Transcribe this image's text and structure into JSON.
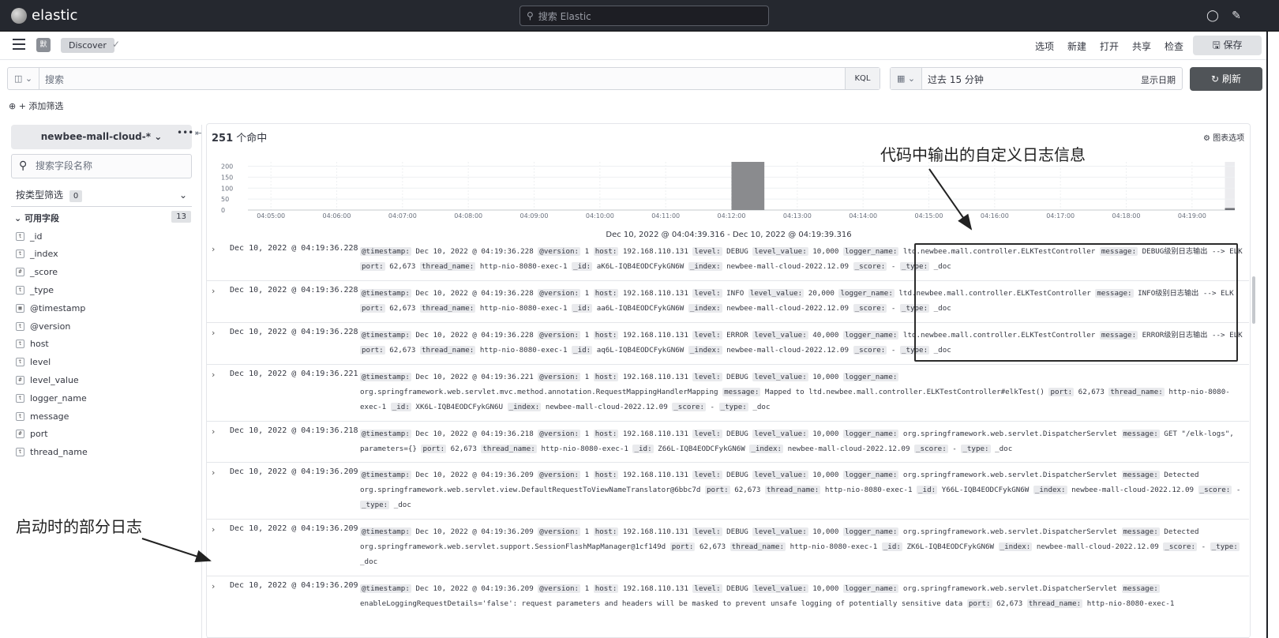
{
  "header": {
    "brand": "elastic",
    "search_placeholder": "搜索 Elastic",
    "icons": [
      "help-icon",
      "newsfeed-icon"
    ]
  },
  "navbar": {
    "space_badge": "默",
    "breadcrumb": "Discover",
    "links": [
      "选项",
      "新建",
      "打开",
      "共享",
      "检查"
    ],
    "save_label": "保存"
  },
  "querybar": {
    "placeholder": "搜索",
    "language": "KQL",
    "date_range": "过去 15 分钟",
    "show_dates": "显示日期",
    "refresh_label": "刷新",
    "add_filter": "+ 添加筛选"
  },
  "sidebar": {
    "index_pattern": "newbee-mall-cloud-*",
    "field_search_placeholder": "搜索字段名称",
    "type_filter_label": "按类型筛选",
    "type_filter_count": "0",
    "available_label": "可用字段",
    "available_count": "13",
    "fields": [
      {
        "name": "_id",
        "type": "t"
      },
      {
        "name": "_index",
        "type": "t"
      },
      {
        "name": "_score",
        "type": "#"
      },
      {
        "name": "_type",
        "type": "t"
      },
      {
        "name": "@timestamp",
        "type": "cal"
      },
      {
        "name": "@version",
        "type": "t"
      },
      {
        "name": "host",
        "type": "t"
      },
      {
        "name": "level",
        "type": "t"
      },
      {
        "name": "level_value",
        "type": "#"
      },
      {
        "name": "logger_name",
        "type": "t"
      },
      {
        "name": "message",
        "type": "t"
      },
      {
        "name": "port",
        "type": "#"
      },
      {
        "name": "thread_name",
        "type": "t"
      }
    ]
  },
  "main": {
    "hits_count": "251",
    "hits_label": "个命中",
    "chart_options": "图表选项",
    "histogram_range": "Dec 10, 2022 @ 04:04:39.316 - Dec 10, 2022 @ 04:19:39.316"
  },
  "chart_data": {
    "type": "bar",
    "x_ticks": [
      "04:05:00",
      "04:06:00",
      "04:07:00",
      "04:08:00",
      "04:09:00",
      "04:10:00",
      "04:11:00",
      "04:12:00",
      "04:13:00",
      "04:14:00",
      "04:15:00",
      "04:16:00",
      "04:17:00",
      "04:18:00",
      "04:19:00"
    ],
    "y_ticks": [
      0,
      50,
      100,
      150,
      200
    ],
    "ylim": [
      0,
      220
    ],
    "bars": [
      {
        "start": "04:12:00",
        "end": "04:12:30",
        "value": 240
      },
      {
        "start": "04:19:30",
        "end": "04:19:39",
        "value": 9
      }
    ],
    "partial_bucket_start": "04:19:30",
    "grid": true
  },
  "rows": [
    {
      "time": "Dec 10, 2022 @ 04:19:36.228",
      "source": [
        [
          "@timestamp:",
          "Dec 10, 2022 @ 04:19:36.228"
        ],
        [
          "@version:",
          "1"
        ],
        [
          "host:",
          "192.168.110.131"
        ],
        [
          "level:",
          "DEBUG"
        ],
        [
          "level_value:",
          "10,000"
        ],
        [
          "logger_name:",
          "ltd.newbee.mall.controller.ELKTestController"
        ],
        [
          "message:",
          "DEBUG级别日志输出 --> ELK"
        ],
        [
          "port:",
          "62,673"
        ],
        [
          "thread_name:",
          "http-nio-8080-exec-1"
        ],
        [
          "_id:",
          "aK6L-IQB4EODCFykGN6W"
        ],
        [
          "_index:",
          "newbee-mall-cloud-2022.12.09"
        ],
        [
          "_score:",
          "-"
        ],
        [
          "_type:",
          "_doc"
        ]
      ]
    },
    {
      "time": "Dec 10, 2022 @ 04:19:36.228",
      "source": [
        [
          "@timestamp:",
          "Dec 10, 2022 @ 04:19:36.228"
        ],
        [
          "@version:",
          "1"
        ],
        [
          "host:",
          "192.168.110.131"
        ],
        [
          "level:",
          "INFO"
        ],
        [
          "level_value:",
          "20,000"
        ],
        [
          "logger_name:",
          "ltd.newbee.mall.controller.ELKTestController"
        ],
        [
          "message:",
          "INFO级别日志输出 --> ELK"
        ],
        [
          "port:",
          "62,673"
        ],
        [
          "thread_name:",
          "http-nio-8080-exec-1"
        ],
        [
          "_id:",
          "aa6L-IQB4EODCFykGN6W"
        ],
        [
          "_index:",
          "newbee-mall-cloud-2022.12.09"
        ],
        [
          "_score:",
          "-"
        ],
        [
          "_type:",
          "_doc"
        ]
      ]
    },
    {
      "time": "Dec 10, 2022 @ 04:19:36.228",
      "source": [
        [
          "@timestamp:",
          "Dec 10, 2022 @ 04:19:36.228"
        ],
        [
          "@version:",
          "1"
        ],
        [
          "host:",
          "192.168.110.131"
        ],
        [
          "level:",
          "ERROR"
        ],
        [
          "level_value:",
          "40,000"
        ],
        [
          "logger_name:",
          "ltd.newbee.mall.controller.ELKTestController"
        ],
        [
          "message:",
          "ERROR级别日志输出 --> ELK"
        ],
        [
          "port:",
          "62,673"
        ],
        [
          "thread_name:",
          "http-nio-8080-exec-1"
        ],
        [
          "_id:",
          "aq6L-IQB4EODCFykGN6W"
        ],
        [
          "_index:",
          "newbee-mall-cloud-2022.12.09"
        ],
        [
          "_score:",
          "-"
        ],
        [
          "_type:",
          "_doc"
        ]
      ]
    },
    {
      "time": "Dec 10, 2022 @ 04:19:36.221",
      "source": [
        [
          "@timestamp:",
          "Dec 10, 2022 @ 04:19:36.221"
        ],
        [
          "@version:",
          "1"
        ],
        [
          "host:",
          "192.168.110.131"
        ],
        [
          "level:",
          "DEBUG"
        ],
        [
          "level_value:",
          "10,000"
        ],
        [
          "logger_name:",
          "org.springframework.web.servlet.mvc.method.annotation.RequestMappingHandlerMapping"
        ],
        [
          "message:",
          "Mapped to ltd.newbee.mall.controller.ELKTestController#elkTest()"
        ],
        [
          "port:",
          "62,673"
        ],
        [
          "thread_name:",
          "http-nio-8080-exec-1"
        ],
        [
          "_id:",
          "XK6L-IQB4EODCFykGN6U"
        ],
        [
          "_index:",
          "newbee-mall-cloud-2022.12.09"
        ],
        [
          "_score:",
          "-"
        ],
        [
          "_type:",
          "_doc"
        ]
      ]
    },
    {
      "time": "Dec 10, 2022 @ 04:19:36.218",
      "source": [
        [
          "@timestamp:",
          "Dec 10, 2022 @ 04:19:36.218"
        ],
        [
          "@version:",
          "1"
        ],
        [
          "host:",
          "192.168.110.131"
        ],
        [
          "level:",
          "DEBUG"
        ],
        [
          "level_value:",
          "10,000"
        ],
        [
          "logger_name:",
          "org.springframework.web.servlet.DispatcherServlet"
        ],
        [
          "message:",
          "GET \"/elk-logs\", parameters={}"
        ],
        [
          "port:",
          "62,673"
        ],
        [
          "thread_name:",
          "http-nio-8080-exec-1"
        ],
        [
          "_id:",
          "Z66L-IQB4EODCFykGN6W"
        ],
        [
          "_index:",
          "newbee-mall-cloud-2022.12.09"
        ],
        [
          "_score:",
          "-"
        ],
        [
          "_type:",
          "_doc"
        ]
      ]
    },
    {
      "time": "Dec 10, 2022 @ 04:19:36.209",
      "source": [
        [
          "@timestamp:",
          "Dec 10, 2022 @ 04:19:36.209"
        ],
        [
          "@version:",
          "1"
        ],
        [
          "host:",
          "192.168.110.131"
        ],
        [
          "level:",
          "DEBUG"
        ],
        [
          "level_value:",
          "10,000"
        ],
        [
          "logger_name:",
          "org.springframework.web.servlet.DispatcherServlet"
        ],
        [
          "message:",
          "Detected org.springframework.web.servlet.view.DefaultRequestToViewNameTranslator@6bbc7d"
        ],
        [
          "port:",
          "62,673"
        ],
        [
          "thread_name:",
          "http-nio-8080-exec-1"
        ],
        [
          "_id:",
          "Y66L-IQB4EODCFykGN6W"
        ],
        [
          "_index:",
          "newbee-mall-cloud-2022.12.09"
        ],
        [
          "_score:",
          "-"
        ],
        [
          "_type:",
          "_doc"
        ]
      ]
    },
    {
      "time": "Dec 10, 2022 @ 04:19:36.209",
      "source": [
        [
          "@timestamp:",
          "Dec 10, 2022 @ 04:19:36.209"
        ],
        [
          "@version:",
          "1"
        ],
        [
          "host:",
          "192.168.110.131"
        ],
        [
          "level:",
          "DEBUG"
        ],
        [
          "level_value:",
          "10,000"
        ],
        [
          "logger_name:",
          "org.springframework.web.servlet.DispatcherServlet"
        ],
        [
          "message:",
          "Detected org.springframework.web.servlet.support.SessionFlashMapManager@1cf149d"
        ],
        [
          "port:",
          "62,673"
        ],
        [
          "thread_name:",
          "http-nio-8080-exec-1"
        ],
        [
          "_id:",
          "ZK6L-IQB4EODCFykGN6W"
        ],
        [
          "_index:",
          "newbee-mall-cloud-2022.12.09"
        ],
        [
          "_score:",
          "-"
        ],
        [
          "_type:",
          "_doc"
        ]
      ]
    },
    {
      "time": "Dec 10, 2022 @ 04:19:36.209",
      "source": [
        [
          "@timestamp:",
          "Dec 10, 2022 @ 04:19:36.209"
        ],
        [
          "@version:",
          "1"
        ],
        [
          "host:",
          "192.168.110.131"
        ],
        [
          "level:",
          "DEBUG"
        ],
        [
          "level_value:",
          "10,000"
        ],
        [
          "logger_name:",
          "org.springframework.web.servlet.DispatcherServlet"
        ],
        [
          "message:",
          "enableLoggingRequestDetails='false': request parameters and headers will be masked to prevent unsafe logging of potentially sensitive data"
        ],
        [
          "port:",
          "62,673"
        ],
        [
          "thread_name:",
          "http-nio-8080-exec-1"
        ]
      ]
    }
  ],
  "annotations": {
    "custom_log": "代码中输出的自定义日志信息",
    "startup_log": "启动时的部分日志"
  }
}
